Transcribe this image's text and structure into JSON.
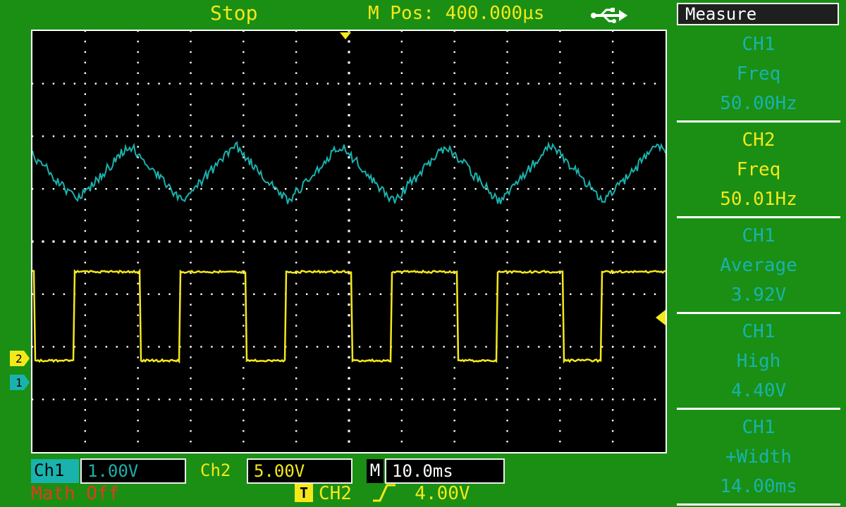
{
  "header": {
    "run_status": "Stop",
    "horizontal_position": "M Pos: 400.000µs",
    "usb_icon": "usb-icon"
  },
  "colors": {
    "ch1": "#1ab2ad",
    "ch2": "#f5e81a",
    "background": "#1a8f14",
    "grid": "#ffffff",
    "math": "#e23b1c"
  },
  "markers": {
    "ch1_ground": "1",
    "ch2_ground": "2"
  },
  "measure": {
    "title": "Measure",
    "items": [
      {
        "channel": "CH1",
        "label": "Freq",
        "value": "50.00Hz",
        "color": "#1ab2ad"
      },
      {
        "channel": "CH2",
        "label": "Freq",
        "value": "50.01Hz",
        "color": "#f5e81a"
      },
      {
        "channel": "CH1",
        "label": "Average",
        "value": "3.92V",
        "color": "#1ab2ad"
      },
      {
        "channel": "CH1",
        "label": "High",
        "value": "4.40V",
        "color": "#1ab2ad"
      },
      {
        "channel": "CH1",
        "label": "+Width",
        "value": "14.00ms",
        "color": "#1ab2ad"
      }
    ]
  },
  "footer": {
    "ch1_label": "Ch1",
    "ch1_scale": "1.00V",
    "ch2_label": "Ch2",
    "ch2_scale": "5.00V",
    "timebase_label": "M",
    "timebase": "10.0ms",
    "math_status": "Math Off",
    "trigger_badge": "T",
    "trigger_source": "CH2",
    "trigger_slope_icon": "rising-edge-icon",
    "trigger_level": "4.00V"
  },
  "waveforms": {
    "ch1_frequency_hz": 50.0,
    "ch2_frequency_hz": 50.01,
    "ch2_shape": "square",
    "ch1_shape": "triangle"
  }
}
